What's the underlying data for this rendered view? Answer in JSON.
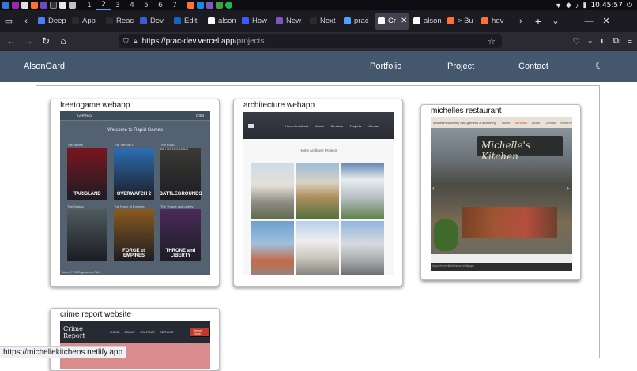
{
  "taskbar": {
    "workspaces": [
      "1",
      "2",
      "3",
      "4",
      "5",
      "6",
      "7"
    ],
    "active_workspace": "2",
    "clock": "10:45:57"
  },
  "browser": {
    "tabs": [
      {
        "label": "Deep",
        "color": "#4c7dff"
      },
      {
        "label": "App",
        "color": "#2b2b2b"
      },
      {
        "label": "Reac",
        "color": "#2b2b2b"
      },
      {
        "label": "Dev",
        "color": "#3b5bdb"
      },
      {
        "label": "Edit",
        "color": "#1565c0"
      },
      {
        "label": "alson",
        "color": "#fafafa"
      },
      {
        "label": "How",
        "color": "#3d5afe"
      },
      {
        "label": "New",
        "color": "#7e57c2"
      },
      {
        "label": "Next",
        "color": "#2b2b2b"
      },
      {
        "label": "prac",
        "color": "#4aa3ff"
      },
      {
        "label": "Cr",
        "color": "#fafafa",
        "active": true
      },
      {
        "label": "alson",
        "color": "#fafafa"
      },
      {
        "label": "> Bu",
        "color": "#ff7139"
      },
      {
        "label": "hov",
        "color": "#ff7139"
      }
    ],
    "url_host": "https://prac-dev.vercel.app",
    "url_path": "/projects",
    "status_url": "https://michellekitchens.netlify.app"
  },
  "site": {
    "brand": "AlsonGard",
    "nav": [
      "Portfolio",
      "Project",
      "Contact"
    ],
    "theme_icon": "moon-icon"
  },
  "projects": [
    {
      "title": "freetogame webapp",
      "screenshot": {
        "top_left": "GAMES",
        "top_right": "Bala",
        "welcome": "Welcome to Rapid Games",
        "games": [
          {
            "label": "The Tamen",
            "art": "TARISLAND",
            "bg": "#7a1620"
          },
          {
            "label": "The Tamnisl 2",
            "art": "OVERWATCH 2",
            "bg": "#2c6fb5"
          },
          {
            "label": "The PUBG BATTLEGROUNDS",
            "art": "BATTLEGROUNDS",
            "bg": "#3b3a34"
          },
          {
            "label": "The Drakan",
            "art": "",
            "bg": "#4f5b5e"
          },
          {
            "label": "The Forge of Empires",
            "art": "FORGE of EMPIRES",
            "bg": "#8a5a1e"
          },
          {
            "label": "The Throne and Liberty",
            "art": "THRONE and LIBERTY",
            "bg": "#4a2a5a"
          }
        ],
        "footer": "Submit Ft 2023 game-info RAC"
      }
    },
    {
      "title": "architecture webapp",
      "screenshot": {
        "nav": [
          "Home Architects",
          "About",
          "Services",
          "Projects",
          "Contact"
        ],
        "subtitle": "Home Architect Projects"
      }
    },
    {
      "title": "michelles restaurant",
      "screenshot": {
        "logo": "Michelle's kitchen|| Ade-gardens & swimming Pool",
        "nav": [
          "Home",
          "Services",
          "About",
          "Contact",
          "Reserve"
        ],
        "active": "Services",
        "sign": "Michelle's Kitchen",
        "footer": "https://michellekitchens.netlify.app"
      }
    },
    {
      "title": "crime report website",
      "screenshot": {
        "logo": "Crime Report",
        "nav": [
          "HOME",
          "ABOUT",
          "CONTACT",
          "SERVICE"
        ],
        "button": "Report Crime"
      }
    }
  ],
  "colors": {
    "header_bg": "#44576c",
    "browser_chrome": "#1c1b22",
    "navbar": "#2b2a33"
  }
}
